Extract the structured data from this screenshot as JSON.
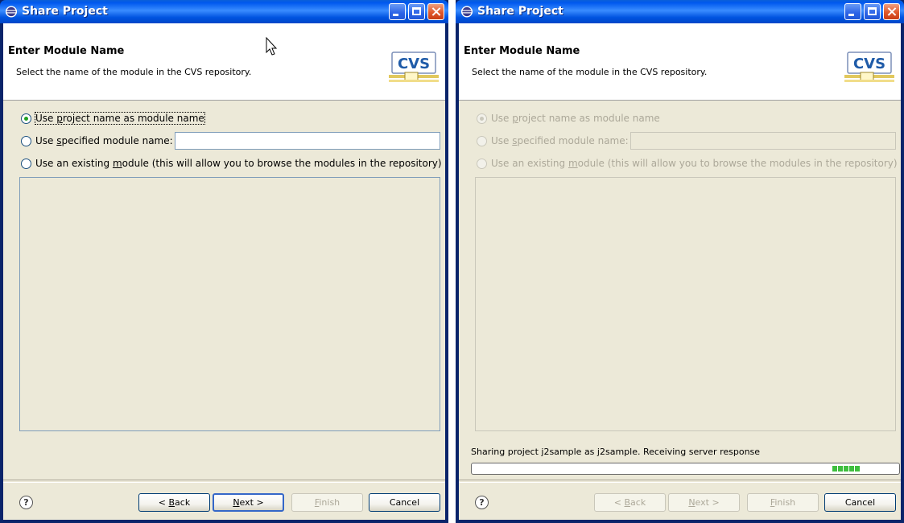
{
  "colors": {
    "titlebar": "#0058ee",
    "client_bg": "#ece9d8",
    "radio_dot": "#21a121",
    "disabled_text": "#aca899",
    "progress": "#3fbf3f"
  },
  "left": {
    "title": "Share Project",
    "banner_title": "Enter Module Name",
    "banner_desc": "Select the name of the module in the CVS repository.",
    "logo_text": "CVS",
    "options": [
      {
        "pre": "Use ",
        "mnemonic": "p",
        "post": "roject name as module name",
        "checked": true
      },
      {
        "pre": "Use ",
        "mnemonic": "s",
        "post": "pecified module name:",
        "checked": false
      },
      {
        "pre": "Use an existing ",
        "mnemonic": "m",
        "post": "odule (this will allow you to browse the modules in the repository)",
        "checked": false
      }
    ],
    "module_field_value": "",
    "buttons": {
      "back": {
        "pre": "< ",
        "mnemonic": "B",
        "post": "ack",
        "enabled": true
      },
      "next": {
        "pre": "",
        "mnemonic": "N",
        "post": "ext >",
        "enabled": true
      },
      "finish": {
        "pre": "",
        "mnemonic": "F",
        "post": "inish",
        "enabled": false
      },
      "cancel": {
        "label": "Cancel",
        "enabled": true
      }
    },
    "help_glyph": "?"
  },
  "right": {
    "title": "Share Project",
    "banner_title": "Enter Module Name",
    "banner_desc": "Select the name of the module in the CVS repository.",
    "logo_text": "CVS",
    "options": [
      {
        "pre": "Use ",
        "mnemonic": "p",
        "post": "roject name as module name",
        "checked": true
      },
      {
        "pre": "Use ",
        "mnemonic": "s",
        "post": "pecified module name:",
        "checked": false
      },
      {
        "pre": "Use an existing ",
        "mnemonic": "m",
        "post": "odule (this will allow you to browse the modules in the repository)",
        "checked": false
      }
    ],
    "module_field_value": "",
    "progress_text": "Sharing project j2sample as j2sample. Receiving server response",
    "progress_segments": 5,
    "buttons": {
      "back": {
        "pre": "< ",
        "mnemonic": "B",
        "post": "ack",
        "enabled": false
      },
      "next": {
        "pre": "",
        "mnemonic": "N",
        "post": "ext >",
        "enabled": false
      },
      "finish": {
        "pre": "",
        "mnemonic": "F",
        "post": "inish",
        "enabled": false
      },
      "cancel": {
        "label": "Cancel",
        "enabled": true
      }
    },
    "help_glyph": "?"
  }
}
